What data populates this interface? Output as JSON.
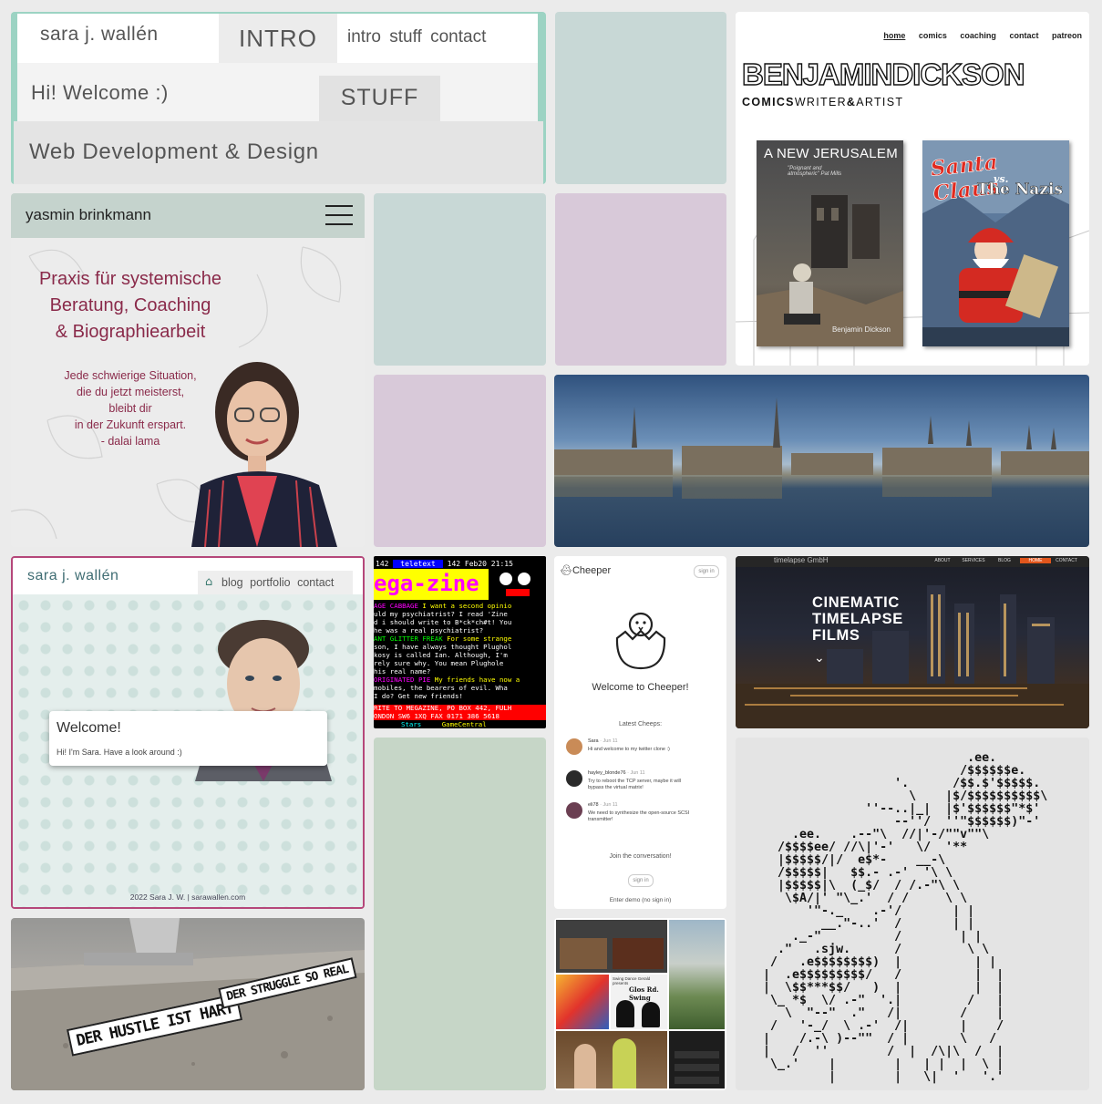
{
  "colors": {
    "page_bg": "#ebebeb",
    "mint_tile": "#c8d8d6",
    "lilac_tile": "#d8c9d9",
    "sage_tile": "#c6d6c7",
    "accent_maroon": "#8a2a4a",
    "teal_frame": "#9cd3c3"
  },
  "tile_sara_intro": {
    "name": "sara j. wallén",
    "tab_intro": "INTRO",
    "nav": [
      "intro",
      "stuff",
      "contact"
    ],
    "welcome": "Hi! Welcome :)",
    "tab_stuff": "STUFF",
    "subtitle": "Web Development & Design"
  },
  "tile_dickson": {
    "nav": [
      "home",
      "comics",
      "coaching",
      "contact",
      "patreon"
    ],
    "name": "BENJAMINDICKSON",
    "tag_a": "COMICS",
    "tag_b": "WRITER",
    "tag_c": "&",
    "tag_d": "ARTIST",
    "book1_title": "A NEW JERUSALEM",
    "book1_quote": "\"Poignant and atmospheric\" Pat Mills",
    "book1_author": "Benjamin Dickson",
    "book2_title_a": "Santa Claus",
    "book2_title_b": "vs.",
    "book2_title_c": "The Nazis"
  },
  "tile_yasmin": {
    "name": "yasmin brinkmann",
    "heading": [
      "Praxis für systemische",
      "Beratung, Coaching",
      "& Biographiearbeit"
    ],
    "quote": [
      "Jede schwierige Situation,",
      "die du jetzt meisterst,",
      "bleibt dir",
      "in der Zukunft erspart.",
      "- dalai lama"
    ]
  },
  "tile_sara_blog": {
    "name": "sara j. wallén",
    "nav": [
      "blog",
      "portfolio",
      "contact"
    ],
    "welcome": "Welcome!",
    "intro": "Hi! I'm Sara. Have a look around :)",
    "footer": "2022 Sara J. W. | sarawallen.com"
  },
  "tile_teletext": {
    "header_a": "142",
    "header_b": "teletext",
    "header_c": "142 Feb20 21:15",
    "logo": "ega-zine",
    "lines": [
      {
        "label": "AGE CABBAGE",
        "text": "I want a second opinio"
      },
      {
        "label": "",
        "text": "uld my psychiatrist? I read 'Zine"
      },
      {
        "label": "",
        "text": "d i should write to B*ck*ch#t! You"
      },
      {
        "label": "",
        "text": "he was a real psychiatrist?"
      },
      {
        "label": "ANT GLITTER FREAK",
        "text": "For some strange"
      },
      {
        "label": "",
        "text": "son, I have always thought Plughol"
      },
      {
        "label": "",
        "text": "kosy is called Ian. Although, I'm"
      },
      {
        "label": "",
        "text": "rely sure why. You mean Plughole"
      },
      {
        "label": "",
        "text": "his real name?"
      },
      {
        "label": "ORIGINATED PIE",
        "text": "My friends have now a"
      },
      {
        "label": "",
        "text": "mobiles, the bearers of evil. Wha"
      },
      {
        "label": "",
        "text": "I do? Get new friends!"
      }
    ],
    "footer1": "RITE TO MEGAZINE, PO BOX 442, FULH",
    "footer2": "ONDON SW6 1XQ  FAX 0171 386 5618",
    "footer3_a": "Stars",
    "footer3_b": "GameCentral"
  },
  "tile_cheeper": {
    "app": "Cheeper",
    "signin": "sign in",
    "welcome": "Welcome to Cheeper!",
    "latest": "Latest Cheeps:",
    "cheeps": [
      {
        "user": "Sara",
        "date": "Jun 11",
        "text": "Hi and welcome to my twitter clone :)"
      },
      {
        "user": "hayley_blonde76",
        "date": "Jun 11",
        "text": "Try to reboot the TCP server, maybe it will bypass the virtual matrix!"
      },
      {
        "user": "eli78",
        "date": "Jun 11",
        "text": "We need to synthesize the open-source SCSI transmitter!"
      }
    ],
    "join": "Join the conversation!",
    "signin2": "sign in",
    "demo": "Enter demo (no sign in)"
  },
  "tile_timelapse": {
    "company": "timelapse GmbH",
    "nav": [
      "ABOUT",
      "SERVICES",
      "BLOG",
      "HOME",
      "CONTACT"
    ],
    "headline": [
      "CINEMATIC",
      "TIMELAPSE",
      "FILMS"
    ]
  },
  "tile_sticker": {
    "sticker1": "DER HUSTLE IST HART",
    "sticker2": "DER STRUGGLE SO REAL"
  },
  "tile_swing": {
    "title": "Swing Dance Gerald presents",
    "poster": "Glos Rd. Swing"
  },
  "tile_ascii": {
    "lines": [
      "                              .ee.",
      "                             /$$$$$$e.",
      "                    '.      /$$.$'$$$$$.",
      "                      \\    |$/$$$$$$$$$$\\",
      "                ''--..|_|  |$'$$$$$$\"*$'",
      "                    --''/  ''\"$$$$$$)\"-'",
      "      .ee.    .--\"\\  //|'-/\"\"v\"\"\\",
      "    /$$$$ee/ //\\|'-'   \\/  '**",
      "    |$$$$$/|/  e$*-    __-\\",
      "    /$$$$$|   $$.- .-'  '\\ \\",
      "    |$$$$$|\\  (_$/  / /.-\"\\ \\",
      "     \\$A/|' \"\\_.'  / /     \\ \\",
      "        '\"-._    .-'/       | |",
      "          __.\"-..'  /       | |",
      "      ._-\"          /        | |",
      "    .\"   .sjw.      /         \\ \\",
      "   /   .e$$$$$$$$)  |          | |",
      "  |  .e$$$$$$$$$/   /          |  |",
      "  |  \\$$***$$/   )  |          |  |",
      "   \\_ *$  \\/ .-\"  '.|         /   |",
      "     \\  \"--\"  .\"   /|        /    |",
      "   /   '-_/  \\ .-'  /|       |    /",
      "  |    /.-\\ )--\"\"  / |       \\   /",
      "  |   /  ''        /  |  /\\|\\  /  |",
      "   \\_.'    |        |   | |  |  \\ |",
      "           |        |   \\|  '   '.'"
    ]
  }
}
